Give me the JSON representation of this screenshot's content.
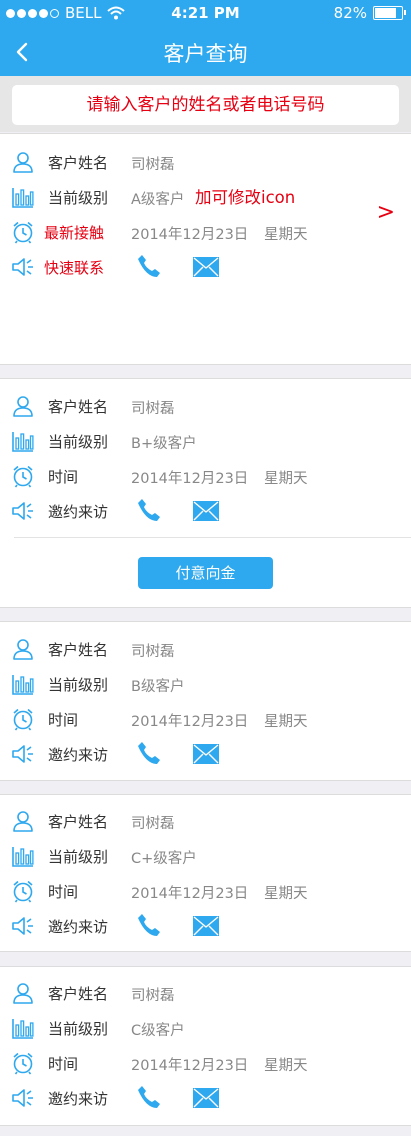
{
  "status_bar": {
    "carrier": "BELL",
    "time": "4:21 PM",
    "battery": "82%",
    "battery_level": 0.82
  },
  "nav": {
    "title": "客户查询",
    "back_icon": "chevron-left-icon"
  },
  "search": {
    "placeholder": "请输入客户的姓名或者电话号码"
  },
  "colors": {
    "primary": "#2ea8ee",
    "annotation_red": "#e60012",
    "background": "#efeff4"
  },
  "customers": [
    {
      "name_label": "客户姓名",
      "name": "司树磊",
      "level_label": "当前级别",
      "level": "A级客户",
      "level_note": "加可修改icon",
      "time_label": "最新接触",
      "date": "2014年12月23日",
      "weekday": "星期天",
      "contact_label": "快速联系",
      "arrow": ">"
    },
    {
      "name_label": "客户姓名",
      "name": "司树磊",
      "level_label": "当前级别",
      "level": "B+级客户",
      "time_label": "时间",
      "date": "2014年12月23日",
      "weekday": "星期天",
      "contact_label": "邀约来访",
      "button_label": "付意向金"
    },
    {
      "name_label": "客户姓名",
      "name": "司树磊",
      "level_label": "当前级别",
      "level": "B级客户",
      "time_label": "时间",
      "date": "2014年12月23日",
      "weekday": "星期天",
      "contact_label": "邀约来访"
    },
    {
      "name_label": "客户姓名",
      "name": "司树磊",
      "level_label": "当前级别",
      "level": "C+级客户",
      "time_label": "时间",
      "date": "2014年12月23日",
      "weekday": "星期天",
      "contact_label": "邀约来访"
    },
    {
      "name_label": "客户姓名",
      "name": "司树磊",
      "level_label": "当前级别",
      "level": "C级客户",
      "time_label": "时间",
      "date": "2014年12月23日",
      "weekday": "星期天",
      "contact_label": "邀约来访"
    }
  ]
}
